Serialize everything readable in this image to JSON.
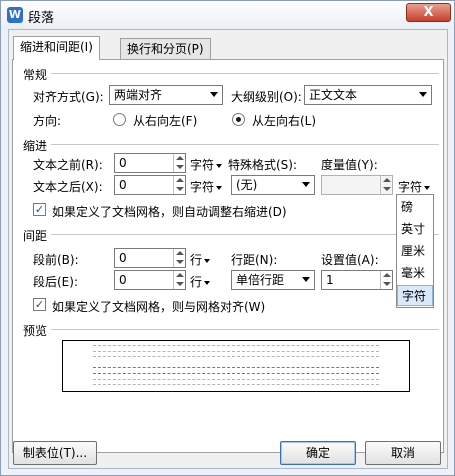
{
  "window": {
    "title": "段落",
    "app_icon_glyph": "W",
    "close_glyph": "X"
  },
  "tabs": [
    {
      "label": "缩进和间距(I)",
      "active": true
    },
    {
      "label": "换行和分页(P)",
      "active": false
    }
  ],
  "general": {
    "section_title": "常规",
    "alignment_label": "对齐方式(G):",
    "alignment_value": "两端对齐",
    "outline_label": "大纲级别(O):",
    "outline_value": "正文文本",
    "direction_label": "方向:",
    "rtl_label": "从右向左(F)",
    "ltr_label": "从左向右(L)",
    "direction_selected": "ltr"
  },
  "indent": {
    "section_title": "缩进",
    "before_label": "文本之前(R):",
    "before_value": "0",
    "before_unit": "字符",
    "after_label": "文本之后(X):",
    "after_value": "0",
    "after_unit": "字符",
    "special_label": "特殊格式(S):",
    "special_value": "(无)",
    "measure_label": "度量值(Y):",
    "measure_value": "",
    "measure_unit": "字符",
    "grid_checkbox_label": "如果定义了文档网格，则自动调整右缩进(D)",
    "grid_checked": true
  },
  "spacing": {
    "section_title": "间距",
    "before_label": "段前(B):",
    "before_value": "0",
    "before_unit": "行",
    "after_label": "段后(E):",
    "after_value": "0",
    "after_unit": "行",
    "line_label": "行距(N):",
    "line_value": "单倍行距",
    "setting_label": "设置值(A):",
    "setting_value": "1",
    "grid_checkbox_label": "如果定义了文档网格，则与网格对齐(W)",
    "grid_checked": true
  },
  "preview": {
    "section_title": "预览"
  },
  "unit_dropdown": {
    "items": [
      "磅",
      "英寸",
      "厘米",
      "毫米",
      "字符"
    ],
    "selected": "字符"
  },
  "buttons": {
    "tabs": "制表位(T)...",
    "ok": "确定",
    "cancel": "取消"
  }
}
